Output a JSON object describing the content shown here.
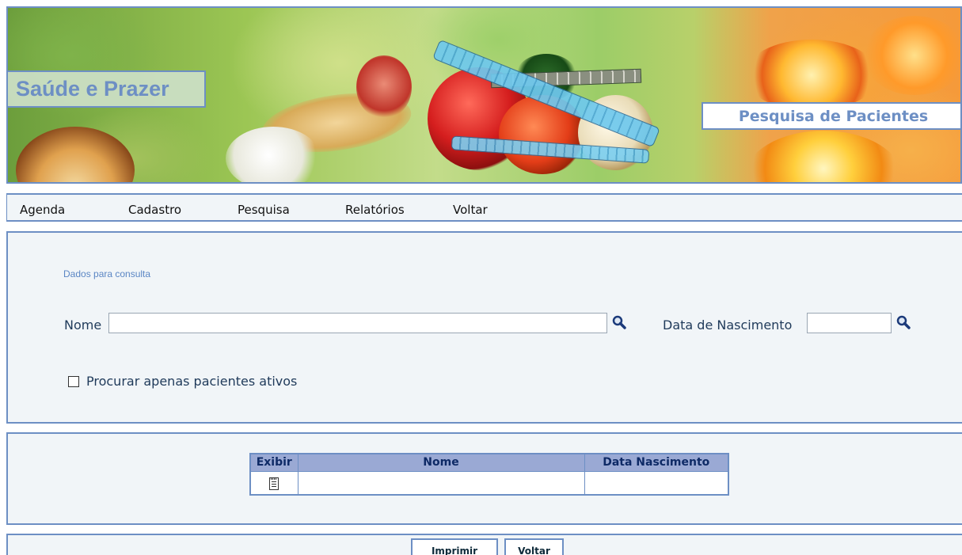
{
  "header": {
    "brand": "Saúde e Prazer",
    "page_title": "Pesquisa de Pacientes"
  },
  "menu": {
    "items": [
      {
        "label": "Agenda"
      },
      {
        "label": "Cadastro"
      },
      {
        "label": "Pesquisa"
      },
      {
        "label": "Relatórios"
      },
      {
        "label": "Voltar"
      }
    ]
  },
  "search": {
    "section_label": "Dados para consulta",
    "name_label": "Nome",
    "name_value": "",
    "birth_label": "Data de Nascimento",
    "birth_value": "",
    "active_only_label": "Procurar apenas pacientes ativos",
    "active_only_checked": false,
    "search_icon": "magnifier-icon"
  },
  "results": {
    "columns": [
      "Exibir",
      "Nome",
      "Data Nascimento"
    ],
    "rows": [
      {
        "exibir_icon": "notepad-icon",
        "nome": "",
        "data_nascimento": ""
      }
    ]
  },
  "footer": {
    "print_label": "Imprimir",
    "back_label": "Voltar"
  },
  "colors": {
    "accent": "#6d8fc4",
    "panel_bg": "#f1f5f8",
    "table_header_bg": "#9aa9d4",
    "table_header_text": "#0e2a66"
  }
}
